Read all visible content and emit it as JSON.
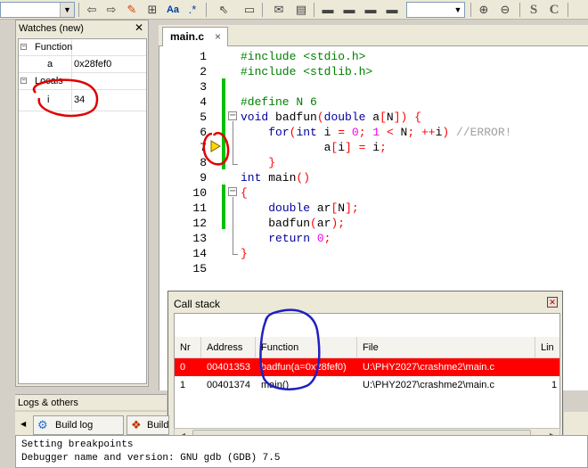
{
  "toolbar": {
    "icons": [
      "back-icon",
      "forward-icon",
      "highlight-icon",
      "match-brace-icon",
      "match-case-icon",
      "regex-icon",
      "select-icon",
      "rectangle-icon",
      "mail-icon",
      "bookmark-icon",
      "panel-icon",
      "panel-icon",
      "panel-icon",
      "panel-icon",
      "zoom-in-icon",
      "zoom-out-icon",
      "s-icon",
      "c-icon"
    ],
    "labels": {
      "match_case": "Aa",
      "regex": ".*",
      "s": "S",
      "c": "C"
    }
  },
  "watches": {
    "title": "Watches (new)",
    "rows": [
      {
        "name": "Function",
        "value": ""
      },
      {
        "name": "a",
        "value": "0x28fef0"
      },
      {
        "name": "Locals",
        "value": ""
      },
      {
        "name": "i",
        "value": "34"
      }
    ]
  },
  "editor": {
    "tab_label": "main.c",
    "tab_close": "×",
    "lines": [
      {
        "n": "1",
        "tokens": [
          [
            "pp",
            "#include <stdio.h>"
          ]
        ]
      },
      {
        "n": "2",
        "tokens": [
          [
            "pp",
            "#include <stdlib.h>"
          ]
        ]
      },
      {
        "n": "3",
        "tokens": []
      },
      {
        "n": "4",
        "tokens": [
          [
            "pp",
            "#define N 6"
          ]
        ]
      },
      {
        "n": "5",
        "tokens": [
          [
            "kw",
            "void"
          ],
          [
            "",
            " badfun"
          ],
          [
            "op",
            "("
          ],
          [
            "kw",
            "double"
          ],
          [
            "",
            " a"
          ],
          [
            "op",
            "["
          ],
          [
            "",
            "N"
          ],
          [
            "op",
            "]"
          ],
          [
            "op",
            ")"
          ],
          [
            "",
            " "
          ],
          [
            "op",
            "{"
          ]
        ]
      },
      {
        "n": "6",
        "tokens": [
          [
            "",
            "    "
          ],
          [
            "kw",
            "for"
          ],
          [
            "op",
            "("
          ],
          [
            "kw",
            "int"
          ],
          [
            "",
            " i "
          ],
          [
            "op",
            "="
          ],
          [
            "",
            " "
          ],
          [
            "num",
            "0"
          ],
          [
            "op",
            ";"
          ],
          [
            "",
            " "
          ],
          [
            "num",
            "1"
          ],
          [
            "",
            " "
          ],
          [
            "op",
            "<"
          ],
          [
            "",
            " N"
          ],
          [
            "op",
            ";"
          ],
          [
            "",
            " "
          ],
          [
            "op",
            "++"
          ],
          [
            "",
            "i"
          ],
          [
            "op",
            ")"
          ],
          [
            "",
            " "
          ],
          [
            "cm",
            "//ERROR!"
          ]
        ]
      },
      {
        "n": "7",
        "tokens": [
          [
            "",
            "            a"
          ],
          [
            "op",
            "["
          ],
          [
            "",
            "i"
          ],
          [
            "op",
            "]"
          ],
          [
            "",
            " "
          ],
          [
            "op",
            "="
          ],
          [
            "",
            " i"
          ],
          [
            "op",
            ";"
          ]
        ]
      },
      {
        "n": "8",
        "tokens": [
          [
            "",
            "    "
          ],
          [
            "op",
            "}"
          ]
        ]
      },
      {
        "n": "9",
        "tokens": [
          [
            "kw",
            "int"
          ],
          [
            "",
            " main"
          ],
          [
            "op",
            "("
          ],
          [
            "op",
            ")"
          ]
        ]
      },
      {
        "n": "10",
        "tokens": [
          [
            "op",
            "{"
          ]
        ]
      },
      {
        "n": "11",
        "tokens": [
          [
            "",
            "    "
          ],
          [
            "kw",
            "double"
          ],
          [
            "",
            " ar"
          ],
          [
            "op",
            "["
          ],
          [
            "",
            "N"
          ],
          [
            "op",
            "]"
          ],
          [
            "op",
            ";"
          ]
        ]
      },
      {
        "n": "12",
        "tokens": [
          [
            "",
            "    badfun"
          ],
          [
            "op",
            "("
          ],
          [
            "",
            "ar"
          ],
          [
            "op",
            ")"
          ],
          [
            "op",
            ";"
          ]
        ]
      },
      {
        "n": "13",
        "tokens": [
          [
            "",
            "    "
          ],
          [
            "kw",
            "return"
          ],
          [
            "",
            " "
          ],
          [
            "num",
            "0"
          ],
          [
            "op",
            ";"
          ]
        ]
      },
      {
        "n": "14",
        "tokens": [
          [
            "op",
            "}"
          ]
        ]
      },
      {
        "n": "15",
        "tokens": []
      }
    ]
  },
  "callstack": {
    "title": "Call stack",
    "columns": [
      "Nr",
      "Address",
      "Function",
      "File",
      "Lin"
    ],
    "rows": [
      [
        "0",
        "00401353",
        "badfun(a=0x28fef0)",
        "U:\\PHY2027\\crashme2\\main.c",
        ""
      ],
      [
        "1",
        "00401374",
        "main()",
        "U:\\PHY2027\\crashme2\\main.c",
        "1"
      ]
    ],
    "selected_row": 0
  },
  "logs": {
    "title": "Logs & others",
    "tabs": [
      "Build log",
      "Build"
    ],
    "lines": [
      "Setting breakpoints",
      "Debugger name and version: GNU gdb (GDB) 7.5"
    ]
  },
  "colors": {
    "keyword": "#0000a0",
    "preprocessor": "#008000",
    "number": "#f000f0",
    "comment": "#a0a0a0",
    "operator": "#ff0000",
    "selected_row": "#ff0000",
    "annotation_red": "#e00000",
    "annotation_blue": "#2020c0",
    "change_bar": "#00c000"
  }
}
